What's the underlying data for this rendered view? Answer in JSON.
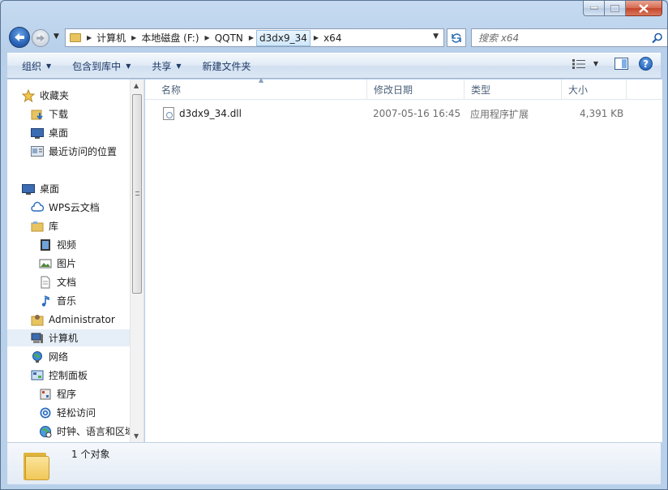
{
  "window": {
    "caption": {
      "minimize": "—",
      "maximize": "▢",
      "close": "✕"
    }
  },
  "address": {
    "crumbs": [
      "计算机",
      "本地磁盘 (F:)",
      "QQTN",
      "d3dx9_34",
      "x64"
    ],
    "active_crumb": "d3dx9_34"
  },
  "search": {
    "placeholder": "搜索 x64"
  },
  "toolbar": {
    "organize": "组织",
    "include_in_library": "包含到库中",
    "share": "共享",
    "new_folder": "新建文件夹"
  },
  "sidebar": {
    "favorites": {
      "label": "收藏夹",
      "items": [
        {
          "label": "下载",
          "icon": "download-folder-icon"
        },
        {
          "label": "桌面",
          "icon": "desktop-icon"
        },
        {
          "label": "最近访问的位置",
          "icon": "recent-places-icon"
        }
      ]
    },
    "desktop": {
      "label": "桌面",
      "items": [
        {
          "label": "WPS云文档",
          "icon": "cloud-icon"
        },
        {
          "label": "库",
          "icon": "library-icon"
        },
        {
          "label": "视频",
          "icon": "video-icon"
        },
        {
          "label": "图片",
          "icon": "picture-icon"
        },
        {
          "label": "文档",
          "icon": "document-icon"
        },
        {
          "label": "音乐",
          "icon": "music-icon"
        },
        {
          "label": "Administrator",
          "icon": "user-folder-icon"
        },
        {
          "label": "计算机",
          "icon": "computer-icon"
        },
        {
          "label": "网络",
          "icon": "network-icon"
        },
        {
          "label": "控制面板",
          "icon": "control-panel-icon"
        },
        {
          "label": "程序",
          "icon": "programs-icon"
        },
        {
          "label": "轻松访问",
          "icon": "ease-of-access-icon"
        },
        {
          "label": "时钟、语言和区域",
          "icon": "clock-language-icon"
        }
      ]
    }
  },
  "columns": {
    "name": "名称",
    "modified": "修改日期",
    "type": "类型",
    "size": "大小"
  },
  "files": [
    {
      "name": "d3dx9_34.dll",
      "modified": "2007-05-16 16:45",
      "type": "应用程序扩展",
      "size": "4,391 KB"
    }
  ],
  "details": {
    "count_text": "1 个对象"
  }
}
